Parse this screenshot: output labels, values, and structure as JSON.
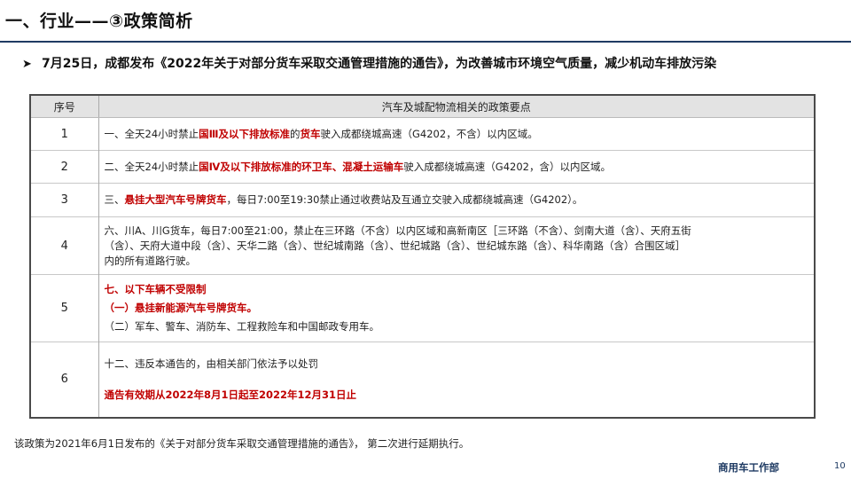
{
  "header": {
    "title": "一、行业——③政策简析"
  },
  "bullet": {
    "arrow": "➤",
    "text": "7月25日，成都发布《2022年关于对部分货车采取交通管理措施的通告》，为改善城市环境空气质量，减少机动车排放污染"
  },
  "table": {
    "col_no": "序号",
    "col_policy": "汽车及城配物流相关的政策要点",
    "rows": [
      {
        "no": "1",
        "line": [
          "一、全天24小时禁止",
          "国Ⅲ及以下排放标准",
          "的",
          "货车",
          "驶入成都绕城高速（G4202，不含）以内区域。"
        ]
      },
      {
        "no": "2",
        "line": [
          "二、全天24小时禁止",
          "国Ⅳ及以下排放标准的环卫车、混凝土运输车",
          "驶入成都绕城高速（G4202，含）以内区域。"
        ]
      },
      {
        "no": "3",
        "line": [
          "三、",
          "悬挂大型汽车号牌货车",
          "，每日7:00至19:30禁止通过收费站及互通立交驶入成都绕城高速（G4202）。"
        ]
      },
      {
        "no": "4",
        "lines": [
          "六、川A、川G货车，每日7:00至21:00，禁止在三环路（不含）以内区域和高新南区［三环路（不含）、剑南大道（含）、天府五街",
          "（含）、天府大道中段（含）、天华二路（含）、世纪城南路（含）、世纪城路（含）、世纪城东路（含）、科华南路（含）合围区域］",
          "内的所有道路行驶。"
        ]
      },
      {
        "no": "5",
        "red_lines": [
          "七、以下车辆不受限制",
          "（一）悬挂新能源汽车号牌货车。"
        ],
        "normal_line": "（二）军车、警车、消防车、工程救险车和中国邮政专用车。"
      },
      {
        "no": "6",
        "line1": "十二、违反本通告的，由相关部门依法予以处罚",
        "red_line": "通告有效期从2022年8月1日起至2022年12月31日止"
      }
    ]
  },
  "footnote": "该政策为2021年6月1日发布的《关于对部分货车采取交通管理措施的通告》，  第二次进行延期执行。",
  "footer": {
    "dept": "商用车工作部",
    "page": "10"
  },
  "colors": {
    "highlight_red": "#c00000",
    "brand_navy": "#1f3b63",
    "header_gray": "#e3e3e3"
  }
}
